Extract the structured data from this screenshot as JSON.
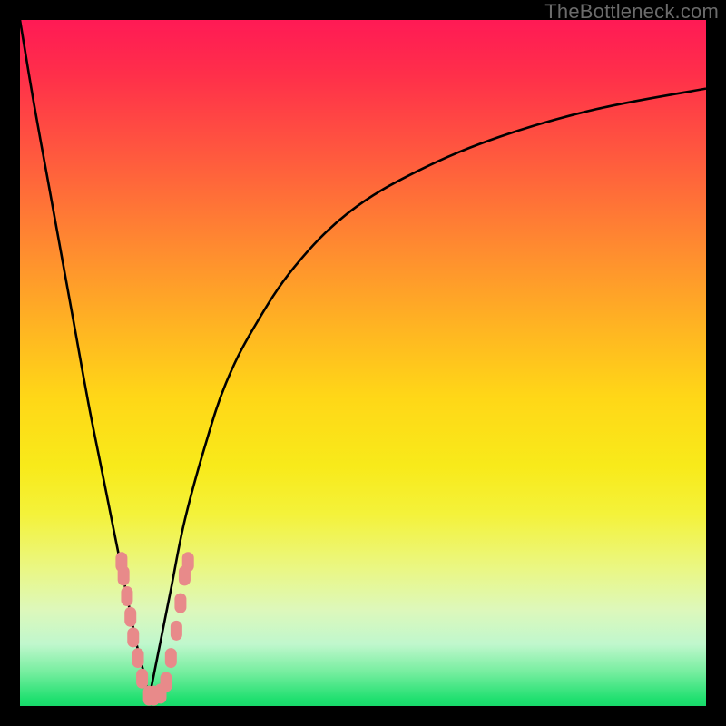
{
  "watermark": "TheBottleneck.com",
  "colors": {
    "frame": "#000000",
    "curve": "#000000",
    "dot": "#e88a8a"
  },
  "chart_data": {
    "type": "line",
    "title": "",
    "xlabel": "",
    "ylabel": "",
    "xlim": [
      0,
      100
    ],
    "ylim": [
      0,
      100
    ],
    "grid": false,
    "series": [
      {
        "name": "left-branch",
        "x": [
          0,
          2,
          4,
          6,
          8,
          10,
          12,
          14,
          15,
          16,
          17,
          18,
          18.8
        ],
        "y": [
          100,
          88,
          77,
          66,
          55,
          44,
          34,
          24,
          19,
          14,
          9,
          5,
          1
        ]
      },
      {
        "name": "right-branch",
        "x": [
          18.8,
          20,
          22,
          24,
          27,
          30,
          34,
          40,
          48,
          58,
          70,
          84,
          100
        ],
        "y": [
          1,
          7,
          17,
          27,
          38,
          47,
          55,
          64,
          72,
          78,
          83,
          87,
          90
        ]
      }
    ],
    "points": [
      {
        "x": 14.8,
        "y": 21
      },
      {
        "x": 15.1,
        "y": 19
      },
      {
        "x": 15.6,
        "y": 16
      },
      {
        "x": 16.1,
        "y": 13
      },
      {
        "x": 16.5,
        "y": 10
      },
      {
        "x": 17.2,
        "y": 7
      },
      {
        "x": 17.8,
        "y": 4
      },
      {
        "x": 18.8,
        "y": 1.5
      },
      {
        "x": 19.5,
        "y": 1.5
      },
      {
        "x": 20.5,
        "y": 1.8
      },
      {
        "x": 21.3,
        "y": 3.5
      },
      {
        "x": 22.0,
        "y": 7
      },
      {
        "x": 22.8,
        "y": 11
      },
      {
        "x": 23.4,
        "y": 15
      },
      {
        "x": 24.0,
        "y": 19
      },
      {
        "x": 24.5,
        "y": 21
      }
    ]
  }
}
